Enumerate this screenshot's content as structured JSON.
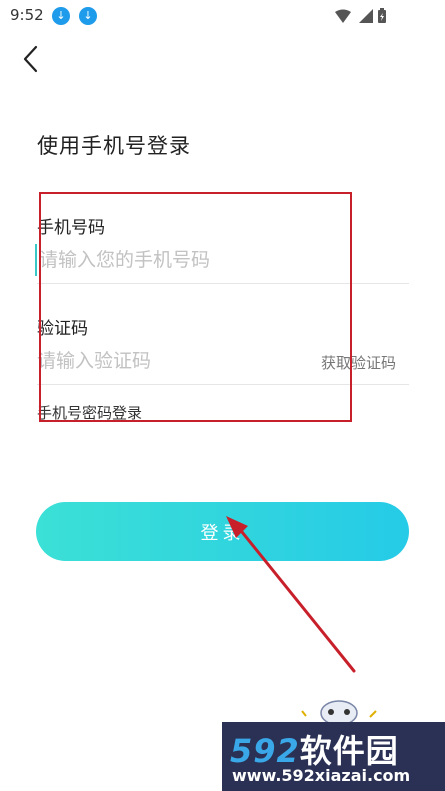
{
  "status_bar": {
    "time": "9:52",
    "download_icon": "↓"
  },
  "page": {
    "title": "使用手机号登录"
  },
  "phone": {
    "label": "手机号码",
    "placeholder": "请输入您的手机号码"
  },
  "code": {
    "label": "验证码",
    "placeholder": "请输入验证码",
    "get_code": "获取验证码"
  },
  "password_login": "手机号密码登录",
  "login_button": "登录",
  "watermark": {
    "brand_num": "592",
    "brand_text": "软件园",
    "url": "www.592xiazai.com"
  },
  "colors": {
    "accent": "#2fd3df",
    "annotation": "#c8202b",
    "watermark_bg": "#2a3154"
  }
}
